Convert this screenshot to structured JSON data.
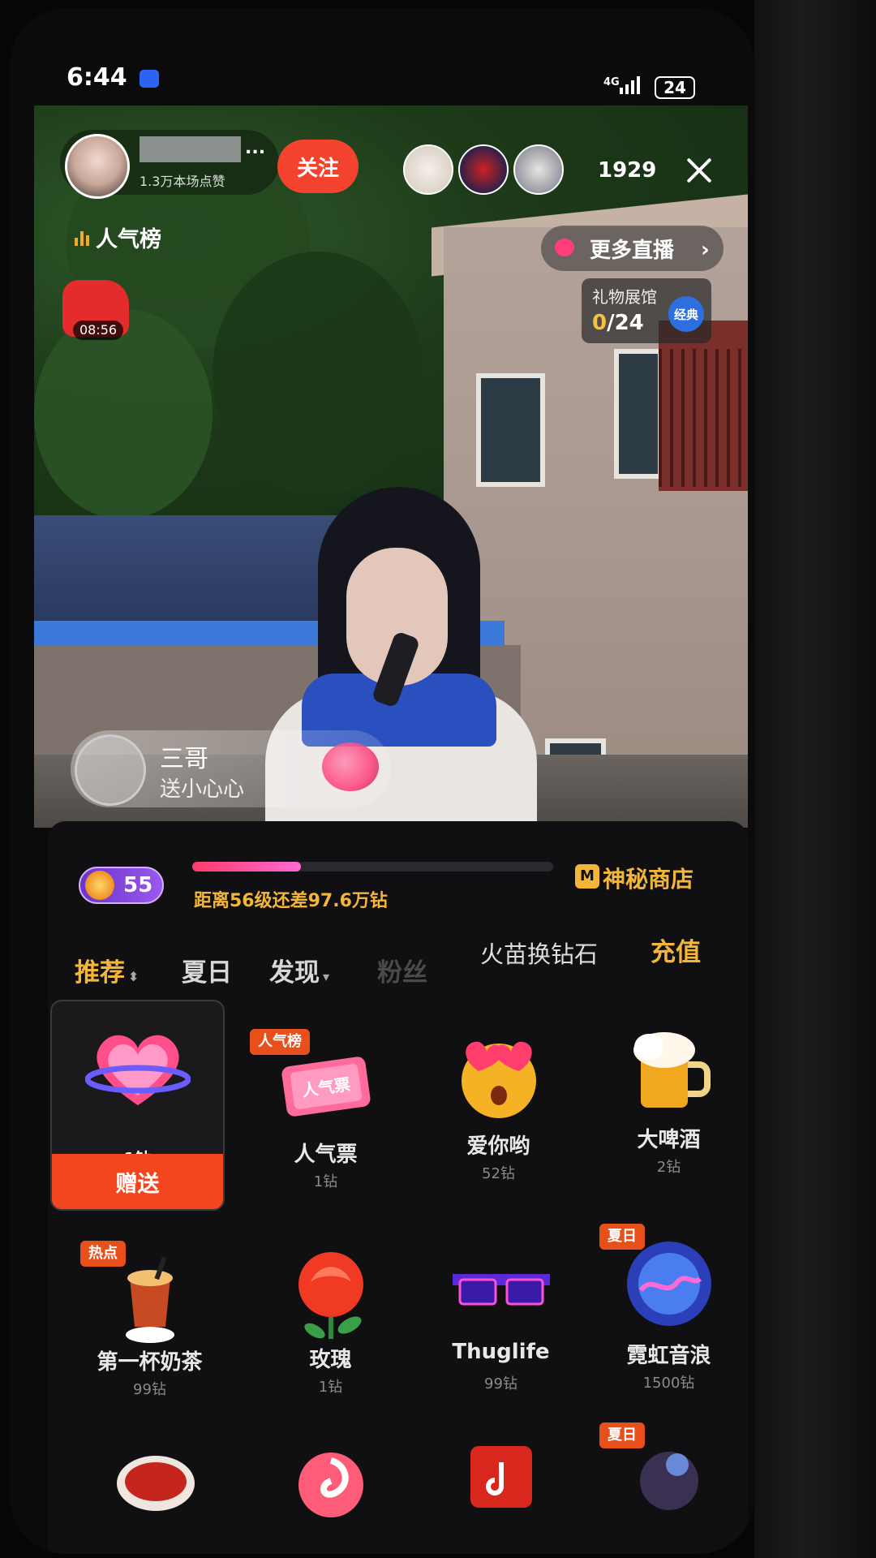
{
  "status_bar": {
    "time": "6:44",
    "network": "4G",
    "battery": "24"
  },
  "anchor": {
    "likes": "1.3万本场点赞",
    "name_suffix": "...",
    "follow_label": "关注"
  },
  "viewers": {
    "count": "1929"
  },
  "overlay": {
    "rank_label": "人气榜",
    "more_live_label": "更多直播",
    "redpack_timer": "08:56",
    "gift_hall_title": "礼物展馆",
    "gift_hall_collected": "0",
    "gift_hall_total": "/24",
    "gift_hall_badge": "经典"
  },
  "gift_notice": {
    "user": "三哥",
    "action": "送小心心"
  },
  "panel": {
    "level": "55",
    "level_progress": 0.3,
    "xp_text": "距离56级还差97.6万钻",
    "shop_label": "神秘商店",
    "shop_icon_letter": "M",
    "tabs": [
      "推荐",
      "夏日",
      "发现",
      "粉丝"
    ],
    "exchange_label": "火苗换钻石",
    "recharge_label": "充值",
    "send_label": "赠送"
  },
  "gifts": [
    {
      "name": "",
      "price": "1钻",
      "tag": "",
      "selected": true,
      "icon": "heart-planet-icon"
    },
    {
      "name": "人气票",
      "price": "1钻",
      "tag": "人气榜",
      "icon": "popularity-ticket-icon",
      "icon_text": "人气票"
    },
    {
      "name": "爱你哟",
      "price": "52钻",
      "tag": "",
      "icon": "love-face-icon"
    },
    {
      "name": "大啤酒",
      "price": "2钻",
      "tag": "",
      "icon": "beer-mug-icon"
    },
    {
      "name": "第一杯奶茶",
      "price": "99钻",
      "tag": "热点",
      "icon": "milk-tea-icon"
    },
    {
      "name": "玫瑰",
      "price": "1钻",
      "tag": "",
      "icon": "rose-icon"
    },
    {
      "name": "Thuglife",
      "price": "99钻",
      "tag": "",
      "icon": "sunglasses-icon"
    },
    {
      "name": "霓虹音浪",
      "price": "1500钻",
      "tag": "夏日",
      "icon": "neon-wave-icon"
    },
    {
      "name": "",
      "price": "",
      "tag": "",
      "icon": "flower-bouquet-icon"
    },
    {
      "name": "",
      "price": "",
      "tag": "",
      "icon": "candy-icon"
    },
    {
      "name": "",
      "price": "",
      "tag": "",
      "icon": "douyin-card-icon"
    },
    {
      "name": "",
      "price": "",
      "tag": "夏日",
      "icon": "summer-figure-icon"
    }
  ]
}
